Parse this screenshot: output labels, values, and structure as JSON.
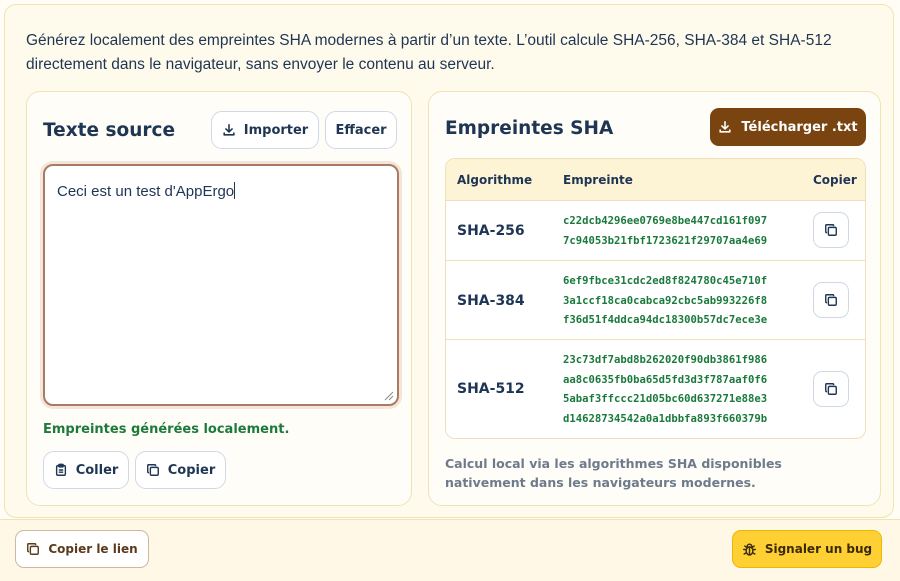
{
  "intro": "Générez localement des empreintes SHA modernes à partir d’un texte. L’outil calcule SHA-256, SHA-384 et SHA-512 directement dans le navigateur, sans envoyer le contenu au serveur.",
  "source": {
    "title": "Texte source",
    "import_label": "Importer",
    "clear_label": "Effacer",
    "text_value": "Ceci est un test d'AppErgo",
    "status": "Empreintes générées localement.",
    "paste_label": "Coller",
    "copy_label": "Copier"
  },
  "hashes": {
    "title": "Empreintes SHA",
    "download_label": "Télécharger .txt",
    "columns": [
      "Algorithme",
      "Empreinte",
      "Copier"
    ],
    "rows": [
      {
        "algorithm": "SHA-256",
        "lines": [
          "c22dcb4296ee0769e8be447cd161f097",
          "7c94053b21fbf1723621f29707aa4e69"
        ]
      },
      {
        "algorithm": "SHA-384",
        "lines": [
          "6ef9fbce31cdc2ed8f824780c45e710f",
          "3a1ccf18ca0cabca92cbc5ab993226f8",
          "f36d51f4ddca94dc18300b57dc7ece3e"
        ]
      },
      {
        "algorithm": "SHA-512",
        "lines": [
          "23c73df7abd8b262020f90db3861f986",
          "aa8c0635fb0ba65d5fd3d3f787aaf0f6",
          "5abaf3ffccc21d05bc60d637271e88e3",
          "d14628734542a0a1dbbfa893f660379b"
        ]
      }
    ],
    "footnote": "Calcul local via les algorithmes SHA disponibles nativement dans les navigateurs modernes."
  },
  "footer": {
    "copy_link_label": "Copier le lien",
    "report_bug_label": "Signaler un bug"
  },
  "colors": {
    "accent_brown": "#7a4410",
    "hash_green": "#1a7a3c",
    "bug_yellow": "#ffd033",
    "text_navy": "#1e3553"
  },
  "icons": [
    "download-icon",
    "copy-icon",
    "clipboard-icon",
    "bug-icon",
    "resize-grip-icon"
  ]
}
